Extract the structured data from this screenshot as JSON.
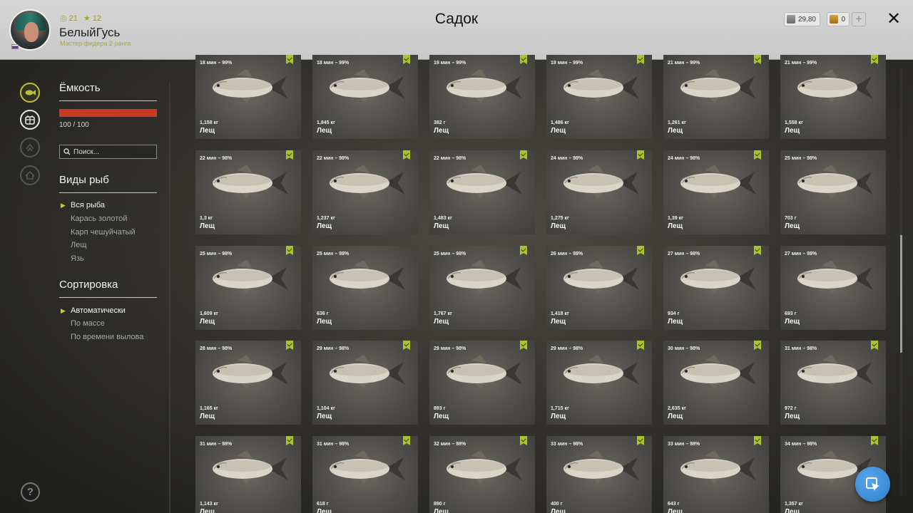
{
  "header": {
    "title": "Садок",
    "player": {
      "name": "БелыйГусь",
      "rank": "Мастер фидера 2 ранга",
      "stat_level": "21",
      "stat_stars": "12"
    },
    "silver": "29,80",
    "gold": "0"
  },
  "sidebar": {
    "capacity_title": "Ёмкость",
    "capacity_text": "100 / 100",
    "capacity_fill": 1.0,
    "search_placeholder": "Поиск...",
    "species_title": "Виды рыб",
    "species": [
      "Вся рыба",
      "Карась золотой",
      "Карп чешуйчатый",
      "Лещ",
      "Язь"
    ],
    "species_selected": 0,
    "sort_title": "Сортировка",
    "sort_options": [
      "Автоматически",
      "По массе",
      "По времени вылова"
    ],
    "sort_selected": 0
  },
  "colors": {
    "accent": "#b9c233",
    "capacity_bar": "#c83a22",
    "fab": "#2c7fd0"
  },
  "icons": {
    "rail": [
      "fish-icon",
      "keepnet-icon",
      "arrow-up-icon",
      "home-icon"
    ],
    "help": "question-icon",
    "fab": "cursor-icon",
    "close": "close-icon"
  },
  "fish": [
    {
      "time": "18 мин – 99%",
      "weight": "1,158 кг",
      "name": "Лещ",
      "marked": true
    },
    {
      "time": "18 мин – 99%",
      "weight": "1,845 кг",
      "name": "Лещ",
      "marked": true
    },
    {
      "time": "19 мин – 99%",
      "weight": "382 г",
      "name": "Лещ",
      "marked": true
    },
    {
      "time": "19 мин – 99%",
      "weight": "1,486 кг",
      "name": "Лещ",
      "marked": true
    },
    {
      "time": "21 мин – 99%",
      "weight": "1,261 кг",
      "name": "Лещ",
      "marked": true
    },
    {
      "time": "21 мин – 99%",
      "weight": "1,558 кг",
      "name": "Лещ",
      "marked": true
    },
    {
      "time": "22 мин – 98%",
      "weight": "1,3 кг",
      "name": "Лещ",
      "marked": true
    },
    {
      "time": "22 мин – 98%",
      "weight": "1,237 кг",
      "name": "Лещ",
      "marked": true
    },
    {
      "time": "22 мин – 98%",
      "weight": "1,483 кг",
      "name": "Лещ",
      "marked": true
    },
    {
      "time": "24 мин – 98%",
      "weight": "1,275 кг",
      "name": "Лещ",
      "marked": true
    },
    {
      "time": "24 мин – 98%",
      "weight": "1,39 кг",
      "name": "Лещ",
      "marked": true
    },
    {
      "time": "25 мин – 98%",
      "weight": "703 г",
      "name": "Лещ",
      "marked": false
    },
    {
      "time": "25 мин – 98%",
      "weight": "1,609 кг",
      "name": "Лещ",
      "marked": true
    },
    {
      "time": "25 мин – 98%",
      "weight": "636 г",
      "name": "Лещ",
      "marked": false
    },
    {
      "time": "25 мин – 98%",
      "weight": "1,767 кг",
      "name": "Лещ",
      "marked": true
    },
    {
      "time": "26 мин – 98%",
      "weight": "1,418 кг",
      "name": "Лещ",
      "marked": true
    },
    {
      "time": "27 мин – 98%",
      "weight": "934 г",
      "name": "Лещ",
      "marked": true
    },
    {
      "time": "27 мин – 98%",
      "weight": "693 г",
      "name": "Лещ",
      "marked": false
    },
    {
      "time": "28 мин – 98%",
      "weight": "1,165 кг",
      "name": "Лещ",
      "marked": true
    },
    {
      "time": "29 мин – 98%",
      "weight": "1,104 кг",
      "name": "Лещ",
      "marked": true
    },
    {
      "time": "29 мин – 98%",
      "weight": "893 г",
      "name": "Лещ",
      "marked": true
    },
    {
      "time": "29 мин – 98%",
      "weight": "1,715 кг",
      "name": "Лещ",
      "marked": true
    },
    {
      "time": "30 мин – 98%",
      "weight": "2,635 кг",
      "name": "Лещ",
      "marked": true
    },
    {
      "time": "31 мин – 98%",
      "weight": "972 г",
      "name": "Лещ",
      "marked": true
    },
    {
      "time": "31 мин – 98%",
      "weight": "1,143 кг",
      "name": "Лещ",
      "marked": true
    },
    {
      "time": "31 мин – 98%",
      "weight": "618 г",
      "name": "Лещ",
      "marked": true
    },
    {
      "time": "32 мин – 98%",
      "weight": "890 г",
      "name": "Лещ",
      "marked": true
    },
    {
      "time": "33 мин – 98%",
      "weight": "400 г",
      "name": "Лещ",
      "marked": true
    },
    {
      "time": "33 мин – 98%",
      "weight": "643 г",
      "name": "Лещ",
      "marked": true
    },
    {
      "time": "34 мин – 98%",
      "weight": "1,357 кг",
      "name": "Лещ",
      "marked": true
    }
  ]
}
